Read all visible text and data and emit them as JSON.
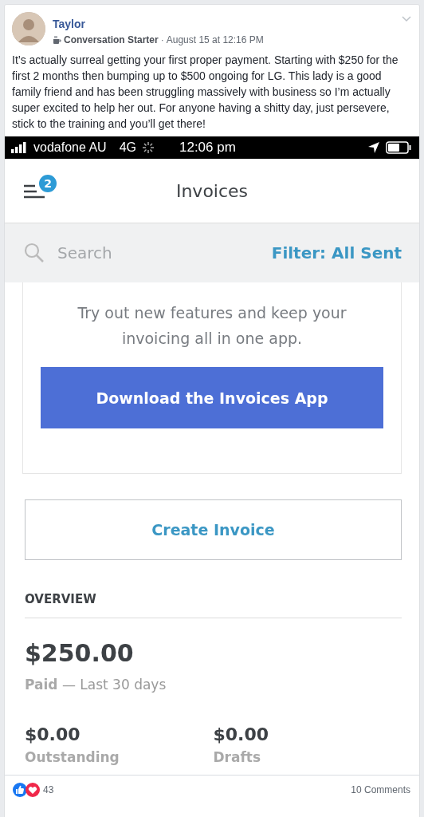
{
  "post": {
    "author": "Taylor",
    "badge": "Conversation Starter",
    "separator": "·",
    "time": "August 15 at 12:16 PM",
    "text": "It’s actually surreal getting your first proper payment. Starting with $250 for the first 2 months then bumping up to $500 ongoing for LG. This lady is a good family friend and has been struggling massively with business so I’m actually super excited to help her out. For anyone having a shitty day, just persevere, stick to the training and you’ll get there!"
  },
  "phone": {
    "status_bar": {
      "carrier": "vodafone AU",
      "network": "4G",
      "time": "12:06 pm"
    },
    "nav": {
      "title": "Invoices",
      "badge": "2"
    },
    "search": {
      "placeholder": "Search",
      "filter": "Filter: All Sent"
    },
    "promo": {
      "text": "Try out new features and keep your invoicing all in one app.",
      "button": "Download the Invoices App"
    },
    "create_button": "Create Invoice",
    "overview": {
      "heading": "OVERVIEW",
      "amount": "$250.00",
      "label": "Paid",
      "period": "— Last 30 days",
      "stats": [
        {
          "amount": "$0.00",
          "label": "Outstanding"
        },
        {
          "amount": "$0.00",
          "label": "Drafts"
        }
      ]
    }
  },
  "footer": {
    "reactions": "43",
    "comments": "10 Comments"
  }
}
